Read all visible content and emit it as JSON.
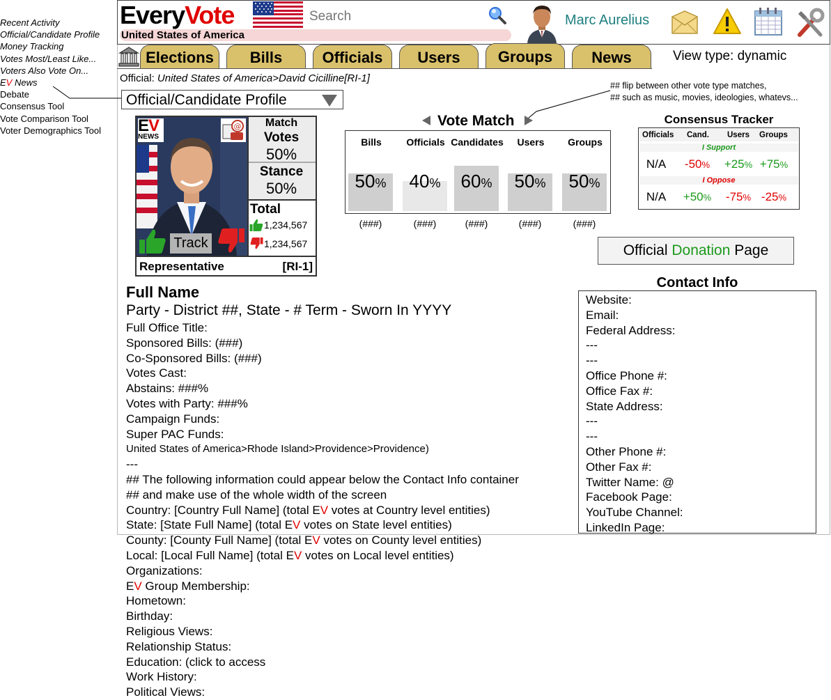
{
  "side_menu": [
    {
      "label": "Recent Activity",
      "italic": true
    },
    {
      "label": "Official/Candidate Profile",
      "italic": true
    },
    {
      "label": "Money Tracking",
      "italic": true
    },
    {
      "label": "Votes Most/Least Like...",
      "italic": true
    },
    {
      "label": "Voters Also Vote On...",
      "italic": true
    },
    {
      "label_prefix": "E",
      "label_accent": "V",
      "label_suffix": " News",
      "italic": true
    },
    {
      "label": "Debate",
      "italic": false
    },
    {
      "label": "Consensus Tool",
      "italic": false
    },
    {
      "label": "Vote Comparison Tool",
      "italic": false
    },
    {
      "label": "Voter Demographics Tool",
      "italic": false
    }
  ],
  "header": {
    "logo_a": "Every",
    "logo_b": "Vote",
    "country": "United States of America",
    "search_placeholder": "Search",
    "username": "Marc Aurelius"
  },
  "nav": {
    "tabs": [
      "Elections",
      "Bills",
      "Officials",
      "Users",
      "Groups",
      "News"
    ],
    "view_type": "View type: dynamic"
  },
  "breadcrumb": {
    "prefix": "Official: ",
    "path": "United States of America>David Cicilline[RI-1]"
  },
  "profile_select": "Official/Candidate Profile",
  "annotation": [
    "## flip between other vote type matches,",
    "## such as music, movies, ideologies, whatevs..."
  ],
  "card": {
    "ev_news_a": "E",
    "ev_news_b": "V",
    "ev_news_small": "NEWS",
    "match_label": "Match",
    "votes_label": "Votes",
    "votes_pct": "50%",
    "stance_label": "Stance",
    "stance_pct": "50%",
    "total_label": "Total",
    "up_count": "1,234,567",
    "down_count": "1,234,567",
    "track_label": "Track",
    "role": "Representative",
    "district": "[RI-1]"
  },
  "vote_match": {
    "title": "Vote Match",
    "columns": [
      {
        "label": "Bills",
        "value": 50,
        "count": "(###)"
      },
      {
        "label": "Officials",
        "value": 40,
        "count": "(###)"
      },
      {
        "label": "Candidates",
        "value": 60,
        "count": "(###)"
      },
      {
        "label": "Users",
        "value": 50,
        "count": "(###)"
      },
      {
        "label": "Groups",
        "value": 50,
        "count": "(###)"
      }
    ]
  },
  "consensus": {
    "title": "Consensus Tracker",
    "headers": [
      "Officials",
      "Cand.",
      "Users",
      "Groups"
    ],
    "support_label": "I Support",
    "oppose_label": "I Oppose",
    "support_row": [
      {
        "text": "N/A",
        "color": "#000000"
      },
      {
        "text": "-50",
        "color": "#e00000"
      },
      {
        "text": "+25",
        "color": "#1c9a1c"
      },
      {
        "text": "+75",
        "color": "#1c9a1c"
      }
    ],
    "oppose_row": [
      {
        "text": "N/A",
        "color": "#000000"
      },
      {
        "text": "+50",
        "color": "#1c9a1c"
      },
      {
        "text": "-75",
        "color": "#e00000"
      },
      {
        "text": "-25",
        "color": "#e00000"
      }
    ],
    "pct": "%"
  },
  "donation": {
    "a": "Official ",
    "b": "Donation",
    "c": " Page"
  },
  "info": {
    "full_name": "Full Name",
    "party_line": "Party - District ##, State - # Term - Sworn In YYYY",
    "lines": [
      "Full Office Title:",
      "Sponsored Bills: (###)",
      "Co-Sponsored Bills: (###)",
      "Votes Cast:",
      "Abstains: ###%",
      "Votes with Party: ###%",
      "Campaign Funds:",
      "Super PAC Funds:",
      "United States of America>Rhode Island>Providence>Providence)",
      "---",
      "## The following information could appear below the Contact Info container",
      "## and make use of the whole width of the screen",
      "Country: [Country Full Name] (total E|V| votes at Country level entities)",
      "State: [State Full Name] (total E|V| votes on State level entities)",
      "County: [County Full Name] (total E|V| votes on County level entities)",
      "Local: [Local Full Name] (total E|V| votes on Local level entities)",
      "Organizations:",
      "E|V| Group Membership:",
      "Hometown:",
      "Birthday:",
      "Religious Views:",
      "Relationship Status:",
      "Education: (click to access",
      "Work History:",
      "Political Views:"
    ]
  },
  "contact": {
    "title": "Contact Info",
    "lines": [
      "Website:",
      "Email:",
      "Federal Address:",
      "---",
      "---",
      "Office Phone #:",
      "Office Fax #:",
      "State Address:",
      "---",
      "---",
      "Other Phone #:",
      "Other Fax #:",
      "Twitter Name: @",
      "Facebook Page:",
      "YouTube Channel:",
      "LinkedIn Page:"
    ]
  },
  "colors": {
    "tab": "#d9c06b",
    "accent_red": "#e00000",
    "accent_green": "#1c9a1c",
    "username": "#1f7f80"
  },
  "icons": [
    "flag-us-icon",
    "search-icon",
    "avatar-icon",
    "mail-icon",
    "alert-icon",
    "calendar-icon",
    "tools-icon",
    "capitol-icon",
    "thumbs-up-icon",
    "thumbs-down-icon",
    "contact-card-icon"
  ]
}
